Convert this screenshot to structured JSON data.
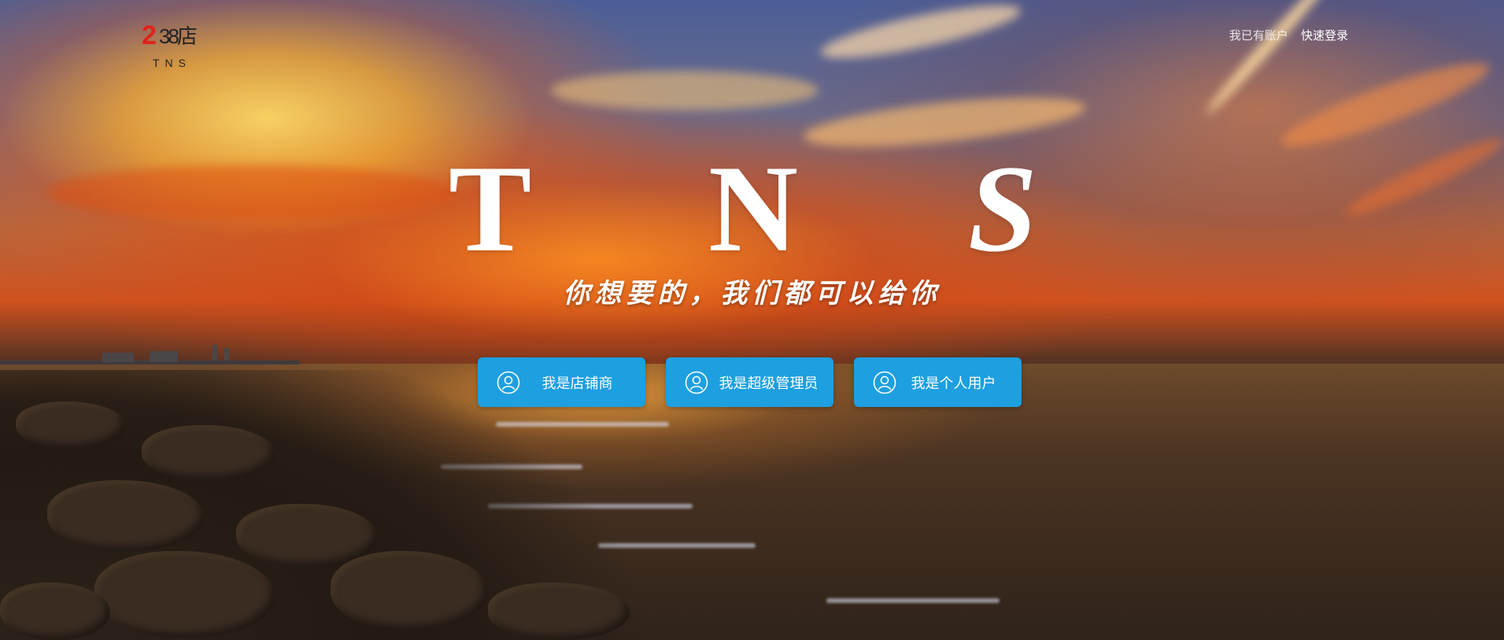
{
  "logo": {
    "number_red": "2",
    "number_dark": "38店",
    "subtitle": "TNS"
  },
  "topbar": {
    "has_account_text": "我已有账户",
    "login_link": "快速登录"
  },
  "hero": {
    "letters": [
      "T",
      "N",
      "S"
    ],
    "slogan": "你想要的，我们都可以给你"
  },
  "roles": [
    {
      "label": "我是店铺商",
      "icon": "user-circle-icon"
    },
    {
      "label": "我是超级管理员",
      "icon": "user-circle-icon"
    },
    {
      "label": "我是个人用户",
      "icon": "user-circle-icon"
    }
  ],
  "colors": {
    "button_blue": "#1d9fe0",
    "logo_red": "#e0231c"
  }
}
